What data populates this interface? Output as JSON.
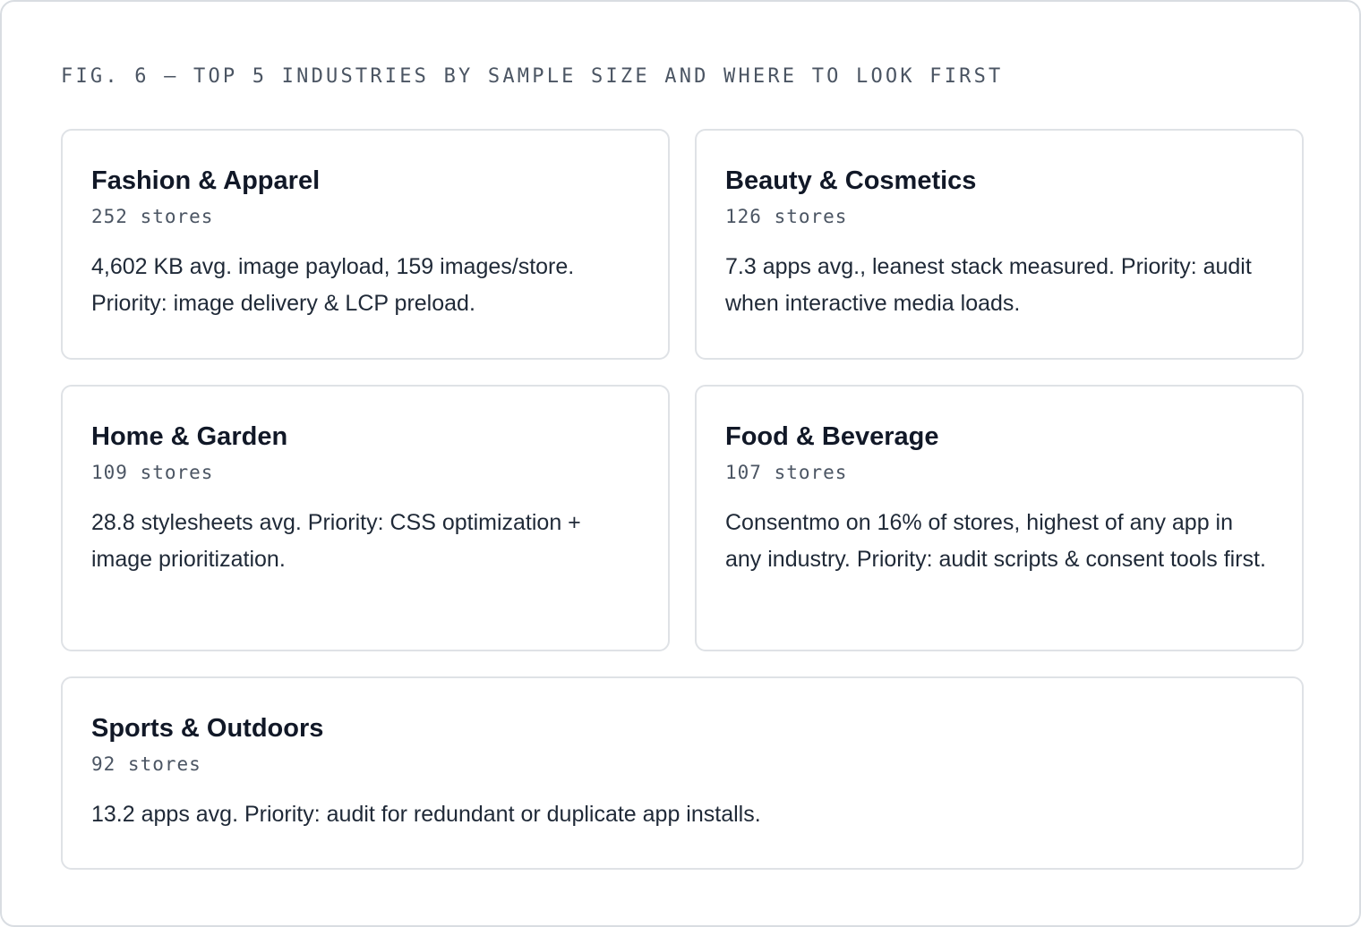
{
  "figure": {
    "caption": "FIG. 6 — TOP 5 INDUSTRIES BY SAMPLE SIZE AND WHERE TO LOOK FIRST"
  },
  "industries": [
    {
      "name": "Fashion & Apparel",
      "stores": "252 stores",
      "description": "4,602 KB avg. image payload, 159 images/store. Priority: image delivery & LCP preload."
    },
    {
      "name": "Beauty & Cosmetics",
      "stores": "126 stores",
      "description": "7.3 apps avg., leanest stack measured. Priority: audit when interactive media loads."
    },
    {
      "name": "Home & Garden",
      "stores": "109 stores",
      "description": "28.8 stylesheets avg. Priority: CSS optimization + image prioritization."
    },
    {
      "name": "Food & Beverage",
      "stores": "107 stores",
      "description": "Consentmo on 16% of stores, highest of any app in any industry. Priority: audit scripts & consent tools first."
    },
    {
      "name": "Sports & Outdoors",
      "stores": "92 stores",
      "description": "13.2 apps avg. Priority: audit for redundant or duplicate app installs."
    }
  ]
}
